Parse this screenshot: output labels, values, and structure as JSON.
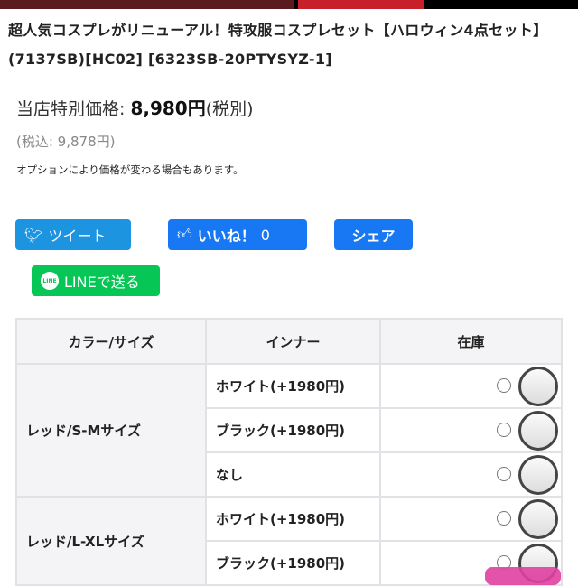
{
  "product": {
    "title": "超人気コスプレがリニューアル！特攻服コスプレセット【ハロウィン4点セット】(7137SB)[HC02] [6323SB-20PTYSYZ-1]",
    "price_label": "当店特別価格: ",
    "price": "8,980円",
    "price_tax_note": "(税別)",
    "tax_included": "(税込: 9,878円)",
    "option_note": "オプションにより価格が変わる場合もあります。"
  },
  "share": {
    "tweet": "ツイート",
    "like": "いいね！",
    "like_count": "0",
    "share": "シェア",
    "line": "LINEで送る",
    "line_icon_text": "LINE"
  },
  "table": {
    "headers": [
      "カラー/サイズ",
      "インナー",
      "在庫"
    ],
    "groups": [
      {
        "label": "レッド/S-Mサイズ",
        "options": [
          "ホワイト(+1980円)",
          "ブラック(+1980円)",
          "なし"
        ]
      },
      {
        "label": "レッド/L-XLサイズ",
        "options": [
          "ホワイト(+1980円)",
          "ブラック(+1980円)"
        ]
      }
    ]
  }
}
